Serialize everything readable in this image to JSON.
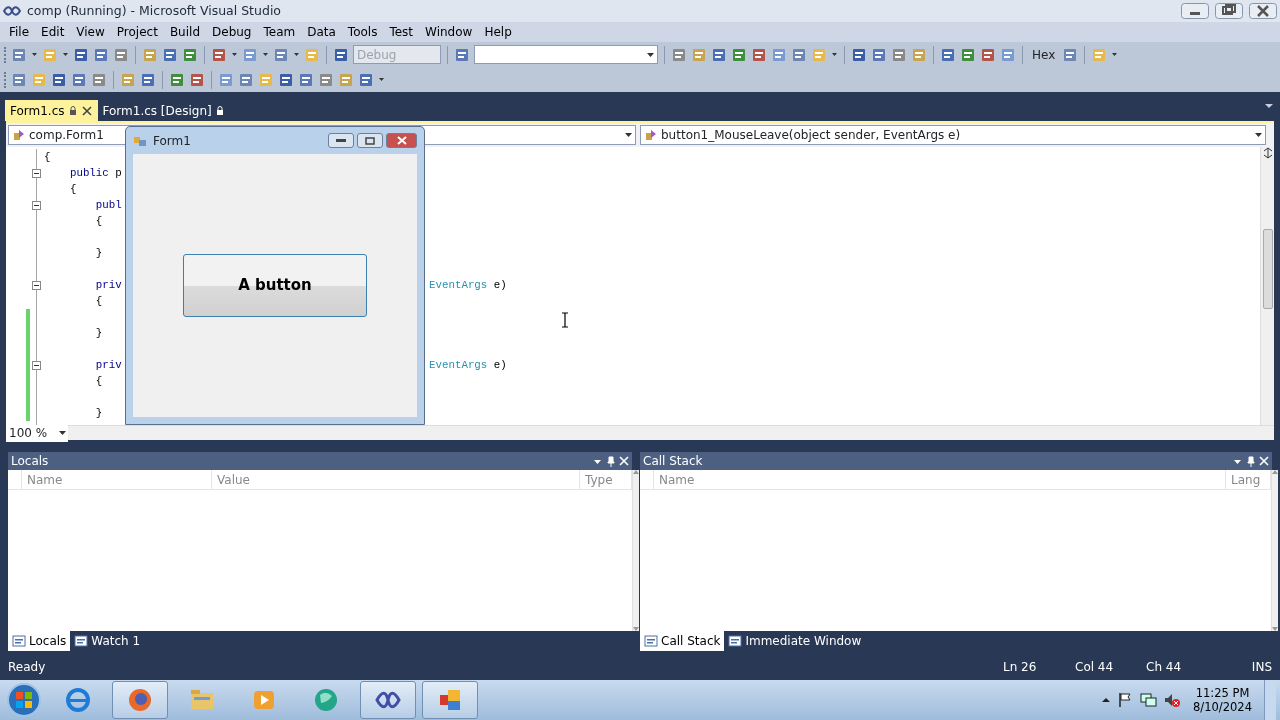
{
  "window": {
    "title": "comp (Running) - Microsoft Visual Studio"
  },
  "menu": [
    "File",
    "Edit",
    "View",
    "Project",
    "Build",
    "Debug",
    "Team",
    "Data",
    "Tools",
    "Test",
    "Window",
    "Help"
  ],
  "toolbar": {
    "configuration": {
      "value": "Debug",
      "disabled": true
    },
    "hex_button": {
      "label": "Hex"
    }
  },
  "document_tabs": [
    {
      "label": "Form1.cs",
      "selected": true
    },
    {
      "label": "Form1.cs [Design]",
      "selected": false
    }
  ],
  "navigation": {
    "type_combo": "comp.Form1",
    "member_combo": "button1_MouseLeave(object sender, EventArgs e)"
  },
  "code_lines": [
    {
      "tokens": [
        {
          "kind": "plain",
          "text": "{"
        }
      ]
    },
    {
      "tokens": [
        {
          "kind": "keyword",
          "text": "    public"
        },
        {
          "kind": "plain",
          "text": " p"
        }
      ],
      "collapsible": true
    },
    {
      "tokens": [
        {
          "kind": "plain",
          "text": "    {"
        }
      ]
    },
    {
      "tokens": [
        {
          "kind": "keyword",
          "text": "        publ"
        }
      ],
      "collapsible": true
    },
    {
      "tokens": [
        {
          "kind": "plain",
          "text": "        {"
        }
      ]
    },
    {
      "kind": "blank"
    },
    {
      "tokens": [
        {
          "kind": "plain",
          "text": "        }"
        }
      ]
    },
    {
      "kind": "blank"
    },
    {
      "tokens": [
        {
          "kind": "keyword",
          "text": "        priv"
        }
      ],
      "right_tokens": [
        {
          "kind": "type",
          "text": "EventArgs"
        },
        {
          "kind": "plain",
          "text": " e)"
        }
      ],
      "collapsible": true
    },
    {
      "tokens": [
        {
          "kind": "plain",
          "text": "        {"
        }
      ]
    },
    {
      "kind": "blank",
      "changed": true
    },
    {
      "tokens": [
        {
          "kind": "plain",
          "text": "        }"
        }
      ],
      "changed": true
    },
    {
      "kind": "blank",
      "changed": true
    },
    {
      "tokens": [
        {
          "kind": "keyword",
          "text": "        priv"
        }
      ],
      "right_tokens": [
        {
          "kind": "type",
          "text": "EventArgs"
        },
        {
          "kind": "plain",
          "text": " e)"
        }
      ],
      "collapsible": true,
      "changed": true
    },
    {
      "tokens": [
        {
          "kind": "plain",
          "text": "        {"
        }
      ],
      "changed": true
    },
    {
      "kind": "blank",
      "changed": true
    },
    {
      "tokens": [
        {
          "kind": "plain",
          "text": "        }"
        }
      ],
      "changed": true
    }
  ],
  "zoom": "100 %",
  "running_form": {
    "title": "Form1",
    "button": "A button"
  },
  "panels": [
    {
      "title": "Locals",
      "columns": [
        "Name",
        "Value",
        "Type"
      ],
      "tabs": [
        {
          "label": "Locals",
          "selected": true
        },
        {
          "label": "Watch 1",
          "selected": false
        }
      ]
    },
    {
      "title": "Call Stack",
      "columns": [
        "Name",
        "Lang"
      ],
      "tabs": [
        {
          "label": "Call Stack",
          "selected": true
        },
        {
          "label": "Immediate Window",
          "selected": false
        }
      ]
    }
  ],
  "status_bar": {
    "message": "Ready",
    "line": "Ln 26",
    "column": "Col 44",
    "character": "Ch 44",
    "mode": "INS"
  },
  "taskbar": {
    "apps": [
      {
        "kind": "ie",
        "open": false
      },
      {
        "kind": "firefox",
        "open": true
      },
      {
        "kind": "folder",
        "open": false
      },
      {
        "kind": "media",
        "open": false
      },
      {
        "kind": "globe",
        "open": false
      },
      {
        "kind": "vs",
        "open": true
      },
      {
        "kind": "office",
        "open": true
      }
    ],
    "time": "11:25 PM",
    "date": "8/10/2024"
  }
}
